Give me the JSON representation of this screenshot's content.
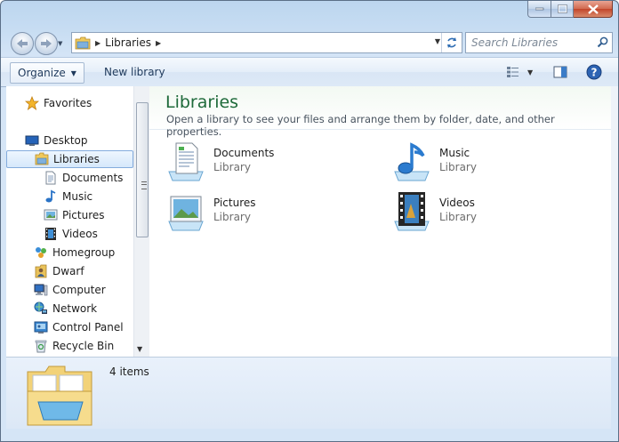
{
  "window": {
    "title": "Libraries",
    "buttons": {
      "minimize": "minimize",
      "maximize": "maximize",
      "close": "close"
    }
  },
  "address": {
    "crumb": "Libraries",
    "search_placeholder": "Search Libraries"
  },
  "toolbar": {
    "organize": "Organize",
    "new_library": "New library"
  },
  "nav": {
    "favorites": "Favorites",
    "desktop": "Desktop",
    "libraries": "Libraries",
    "documents": "Documents",
    "music": "Music",
    "pictures": "Pictures",
    "videos": "Videos",
    "homegroup": "Homegroup",
    "dwarf": "Dwarf",
    "computer": "Computer",
    "network": "Network",
    "control_panel": "Control Panel",
    "recycle_bin": "Recycle Bin"
  },
  "content": {
    "title": "Libraries",
    "description": "Open a library to see your files and arrange them by folder, date, and other properties.",
    "libraries": [
      {
        "name": "Documents",
        "type": "Library"
      },
      {
        "name": "Music",
        "type": "Library"
      },
      {
        "name": "Pictures",
        "type": "Library"
      },
      {
        "name": "Videos",
        "type": "Library"
      }
    ]
  },
  "details": {
    "count": "4 items"
  },
  "colors": {
    "title_green": "#1e6a3a",
    "selection_blue": "#84acdd",
    "close_red": "#c2462b"
  }
}
